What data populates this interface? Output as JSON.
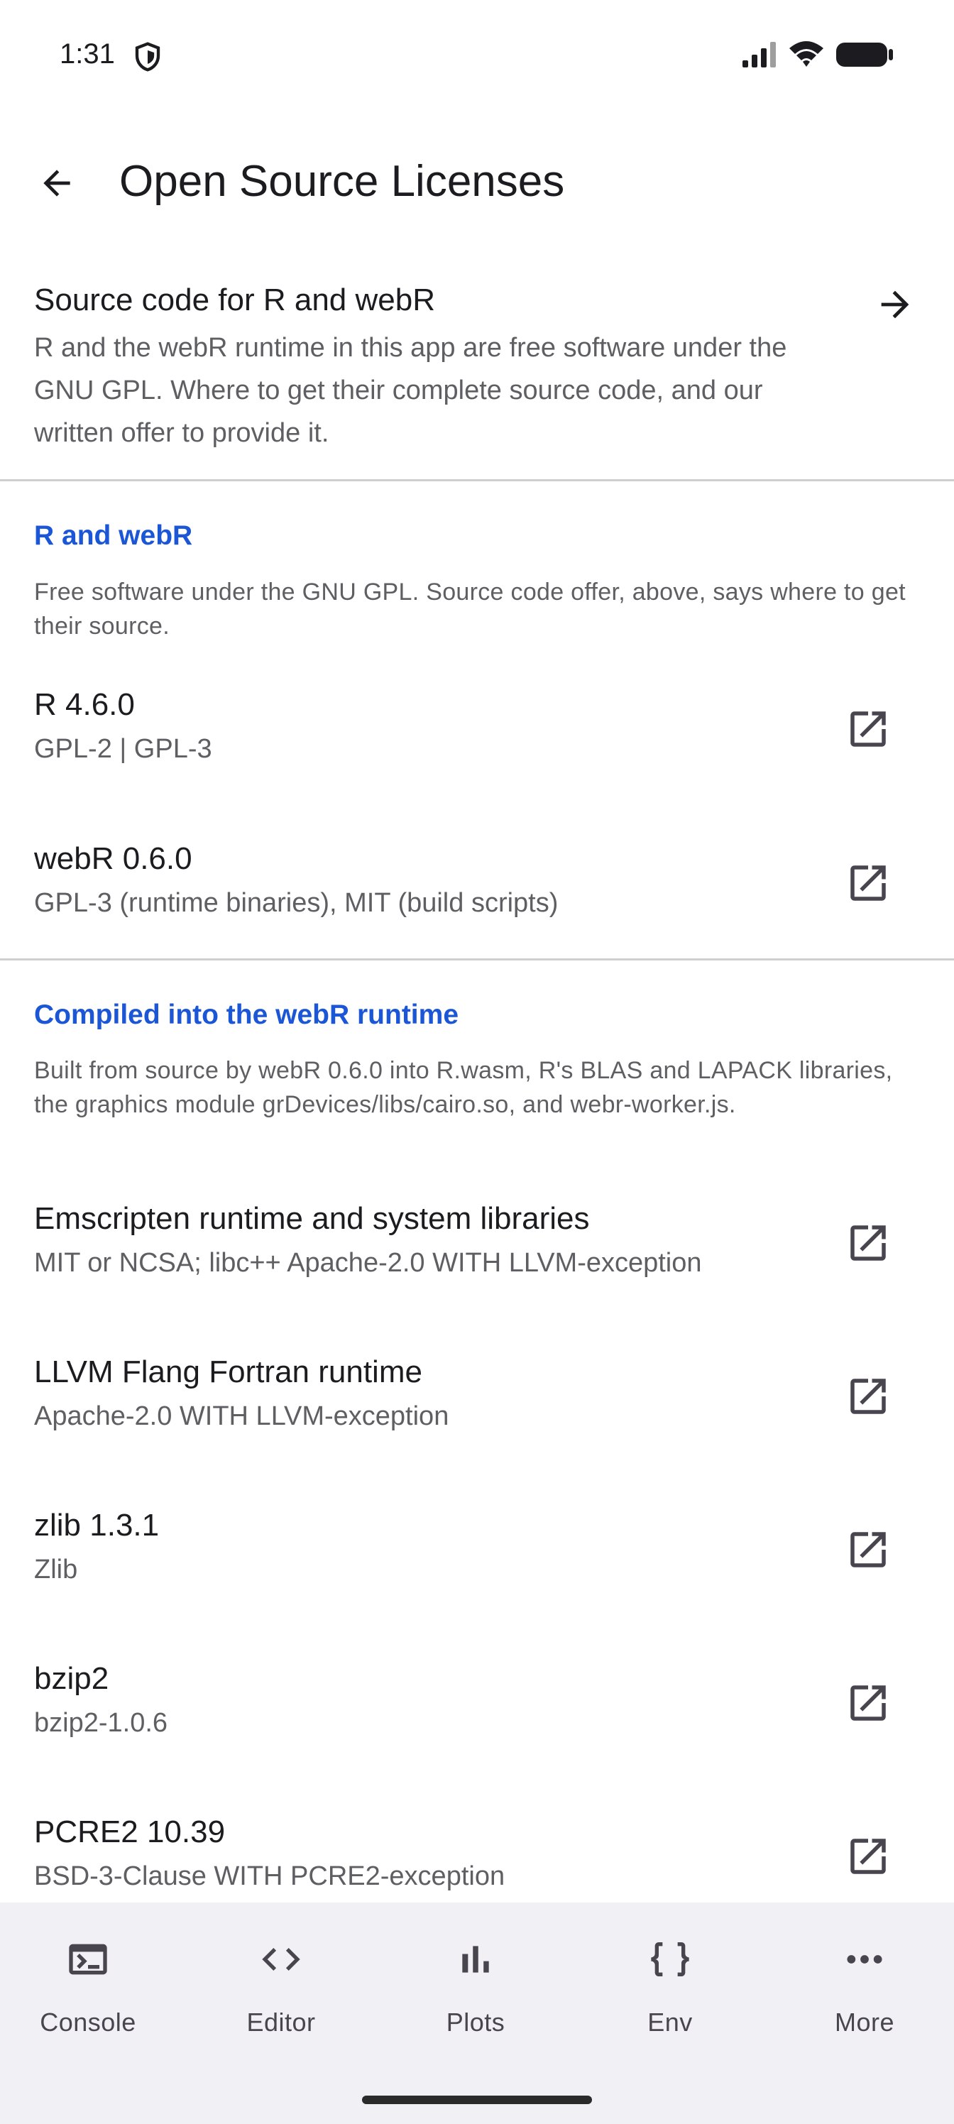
{
  "status_bar": {
    "time": "1:31"
  },
  "app_bar": {
    "title": "Open Source Licenses"
  },
  "source_code": {
    "title": "Source code for R and webR",
    "description": "R and the webR runtime in this app are free software under the GNU GPL. Where to get their complete source code, and our written offer to provide it."
  },
  "sections": [
    {
      "header": "R and webR",
      "description": "Free software under the GNU GPL. Source code offer, above, says where to get their source.",
      "items": [
        {
          "name": "R 4.6.0",
          "license": "GPL-2 | GPL-3"
        },
        {
          "name": "webR 0.6.0",
          "license": "GPL-3 (runtime binaries), MIT (build scripts)"
        }
      ]
    },
    {
      "header": "Compiled into the webR runtime",
      "description": "Built from source by webR 0.6.0 into R.wasm, R's BLAS and LAPACK libraries, the graphics module grDevices/libs/cairo.so, and webr-worker.js.",
      "items": [
        {
          "name": "Emscripten runtime and system libraries",
          "license": "MIT or NCSA; libc++ Apache-2.0 WITH LLVM-exception"
        },
        {
          "name": "LLVM Flang Fortran runtime",
          "license": "Apache-2.0 WITH LLVM-exception"
        },
        {
          "name": "zlib 1.3.1",
          "license": "Zlib"
        },
        {
          "name": "bzip2",
          "license": "bzip2-1.0.6"
        },
        {
          "name": "PCRE2 10.39",
          "license": "BSD-3-Clause WITH PCRE2-exception"
        }
      ]
    }
  ],
  "bottom_nav": [
    {
      "label": "Console",
      "icon": "console-icon"
    },
    {
      "label": "Editor",
      "icon": "code-icon"
    },
    {
      "label": "Plots",
      "icon": "bar-chart-icon"
    },
    {
      "label": "Env",
      "icon": "braces-icon"
    },
    {
      "label": "More",
      "icon": "more-horiz-icon"
    }
  ],
  "colors": {
    "accent": "#1b56d6",
    "nav_background": "#f1f0f5",
    "divider": "#cfcfcf"
  }
}
